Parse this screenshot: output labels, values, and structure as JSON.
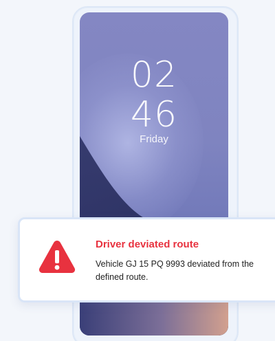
{
  "lockscreen": {
    "hours": "02",
    "minutes": "46",
    "day": "Friday"
  },
  "notification": {
    "title": "Driver deviated route",
    "body": "Vehicle GJ 15 PQ 9993 deviated from the defined route.",
    "icon": "warning-triangle-icon",
    "accent_color": "#e8323f"
  }
}
